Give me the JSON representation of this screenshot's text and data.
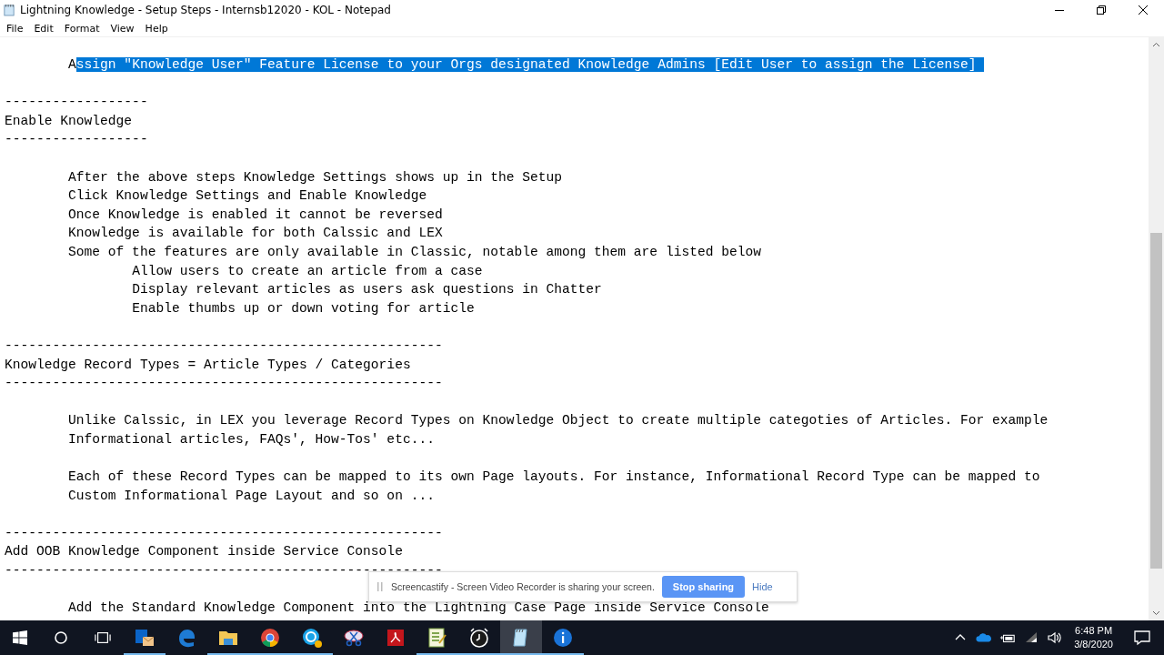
{
  "window": {
    "title": "Lightning Knowledge - Setup Steps - Internsb12020 - KOL - Notepad"
  },
  "menu": [
    "File",
    "Edit",
    "Format",
    "View",
    "Help"
  ],
  "lines": [
    {
      "kind": "text",
      "segments": [
        {
          "text": "\tA",
          "selected": false
        },
        {
          "text": "ssign \"Knowledge User\" Feature License to your Orgs designated Knowledge Admins [Edit User to assign the License] ",
          "selected": true
        }
      ]
    },
    {
      "kind": "blank"
    },
    {
      "kind": "text",
      "text": "------------------"
    },
    {
      "kind": "text",
      "text": "Enable Knowledge"
    },
    {
      "kind": "text",
      "text": "------------------"
    },
    {
      "kind": "blank"
    },
    {
      "kind": "text",
      "text": "\tAfter the above steps Knowledge Settings shows up in the Setup"
    },
    {
      "kind": "text",
      "text": "\tClick Knowledge Settings and Enable Knowledge"
    },
    {
      "kind": "text",
      "text": "\tOnce Knowledge is enabled it cannot be reversed"
    },
    {
      "kind": "text",
      "text": "\tKnowledge is available for both Calssic and LEX"
    },
    {
      "kind": "text",
      "text": "\tSome of the features are only available in Classic, notable among them are listed below"
    },
    {
      "kind": "text",
      "text": "\t\tAllow users to create an article from a case"
    },
    {
      "kind": "text",
      "text": "\t\tDisplay relevant articles as users ask questions in Chatter"
    },
    {
      "kind": "text",
      "text": "\t\tEnable thumbs up or down voting for article"
    },
    {
      "kind": "blank"
    },
    {
      "kind": "text",
      "text": "-------------------------------------------------------"
    },
    {
      "kind": "text",
      "text": "Knowledge Record Types = Article Types / Categories"
    },
    {
      "kind": "text",
      "text": "-------------------------------------------------------"
    },
    {
      "kind": "blank"
    },
    {
      "kind": "text",
      "text": "\tUnlike Calssic, in LEX you leverage Record Types on Knowledge Object to create multiple categoties of Articles. For example"
    },
    {
      "kind": "text",
      "text": "\tInformational articles, FAQs', How-Tos' etc..."
    },
    {
      "kind": "blank"
    },
    {
      "kind": "text",
      "text": "\tEach of these Record Types can be mapped to its own Page layouts. For instance, Informational Record Type can be mapped to"
    },
    {
      "kind": "text",
      "text": "\tCustom Informational Page Layout and so on ..."
    },
    {
      "kind": "blank"
    },
    {
      "kind": "text",
      "text": "-------------------------------------------------------"
    },
    {
      "kind": "text",
      "text": "Add OOB Knowledge Component inside Service Console"
    },
    {
      "kind": "text",
      "text": "-------------------------------------------------------"
    },
    {
      "kind": "blank"
    },
    {
      "kind": "text",
      "text": "\tAdd the Standard Knowledge Component into the Lightning Case Page inside Service Console"
    }
  ],
  "share_bar": {
    "message": "Screencastify - Screen Video Recorder is sharing your screen.",
    "stop_button": "Stop sharing",
    "hide_link": "Hide"
  },
  "taskbar": {
    "apps": [
      {
        "kind": "outlook",
        "running": true,
        "selected": false
      },
      {
        "kind": "edge",
        "running": false,
        "selected": false
      },
      {
        "kind": "explorer",
        "running": true,
        "selected": false
      },
      {
        "kind": "chrome",
        "running": true,
        "selected": false
      },
      {
        "kind": "skype",
        "running": true,
        "selected": false
      },
      {
        "kind": "snip",
        "running": false,
        "selected": false
      },
      {
        "kind": "pdf",
        "running": false,
        "selected": false
      },
      {
        "kind": "sheet",
        "running": true,
        "selected": false
      },
      {
        "kind": "clock",
        "running": true,
        "selected": false
      },
      {
        "kind": "notepad",
        "running": true,
        "selected": true
      },
      {
        "kind": "info",
        "running": true,
        "selected": false
      }
    ],
    "time": "6:48 PM",
    "date": "3/8/2020"
  }
}
